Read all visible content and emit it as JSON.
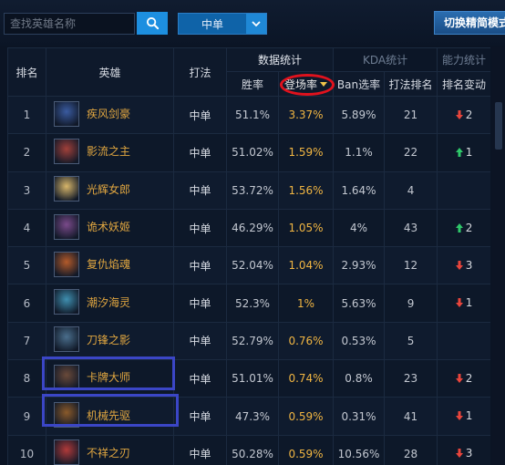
{
  "search": {
    "placeholder": "查找英雄名称"
  },
  "lane_select": {
    "value": "中单"
  },
  "switch_button": {
    "label": "切换精简模式"
  },
  "table": {
    "headers": {
      "rank": "排名",
      "hero": "英雄",
      "lane": "打法",
      "tabs": [
        "数据统计",
        "KDA统计",
        "能力统计"
      ],
      "win": "胜率",
      "pick": "登场率",
      "ban": "Ban选率",
      "lane_rank": "打法排名",
      "rank_change": "排名变动"
    },
    "rows": [
      {
        "rank": "1",
        "hero": "疾风剑豪",
        "lane": "中单",
        "win": "51.1%",
        "pick": "3.37%",
        "ban": "5.89%",
        "lane_rank": "21",
        "change_dir": "down",
        "change": "2",
        "avatar": "#3a5ba0"
      },
      {
        "rank": "2",
        "hero": "影流之主",
        "lane": "中单",
        "win": "51.02%",
        "pick": "1.59%",
        "ban": "1.1%",
        "lane_rank": "22",
        "change_dir": "up",
        "change": "1",
        "avatar": "#a0403a"
      },
      {
        "rank": "3",
        "hero": "光辉女郎",
        "lane": "中单",
        "win": "53.72%",
        "pick": "1.56%",
        "ban": "1.64%",
        "lane_rank": "4",
        "change_dir": "",
        "change": "",
        "avatar": "#d8b66a"
      },
      {
        "rank": "4",
        "hero": "诡术妖姬",
        "lane": "中单",
        "win": "46.29%",
        "pick": "1.05%",
        "ban": "4%",
        "lane_rank": "43",
        "change_dir": "up",
        "change": "2",
        "avatar": "#7a4a8a"
      },
      {
        "rank": "5",
        "hero": "复仇焰魂",
        "lane": "中单",
        "win": "52.04%",
        "pick": "1.04%",
        "ban": "2.93%",
        "lane_rank": "12",
        "change_dir": "down",
        "change": "3",
        "avatar": "#b35a2a"
      },
      {
        "rank": "6",
        "hero": "潮汐海灵",
        "lane": "中单",
        "win": "52.3%",
        "pick": "1%",
        "ban": "5.63%",
        "lane_rank": "9",
        "change_dir": "down",
        "change": "1",
        "avatar": "#3f8fb0"
      },
      {
        "rank": "7",
        "hero": "刀锋之影",
        "lane": "中单",
        "win": "52.79%",
        "pick": "0.76%",
        "ban": "0.53%",
        "lane_rank": "5",
        "change_dir": "",
        "change": "",
        "avatar": "#4a6e8c"
      },
      {
        "rank": "8",
        "hero": "卡牌大师",
        "lane": "中单",
        "win": "51.01%",
        "pick": "0.74%",
        "ban": "0.8%",
        "lane_rank": "23",
        "change_dir": "down",
        "change": "2",
        "avatar": "#6a4a3a"
      },
      {
        "rank": "9",
        "hero": "机械先驱",
        "lane": "中单",
        "win": "47.3%",
        "pick": "0.59%",
        "ban": "0.31%",
        "lane_rank": "41",
        "change_dir": "down",
        "change": "1",
        "avatar": "#8a5a2a"
      },
      {
        "rank": "10",
        "hero": "不祥之刃",
        "lane": "中单",
        "win": "50.28%",
        "pick": "0.59%",
        "ban": "10.56%",
        "lane_rank": "28",
        "change_dir": "down",
        "change": "3",
        "avatar": "#b03a3a"
      }
    ]
  },
  "colors": {
    "accent": "#1d8fe0",
    "hero_name": "#e0a640",
    "up": "#2fc86a",
    "down": "#e8453c",
    "circle": "#e0121d",
    "highlight_box": "#3b46c6"
  }
}
